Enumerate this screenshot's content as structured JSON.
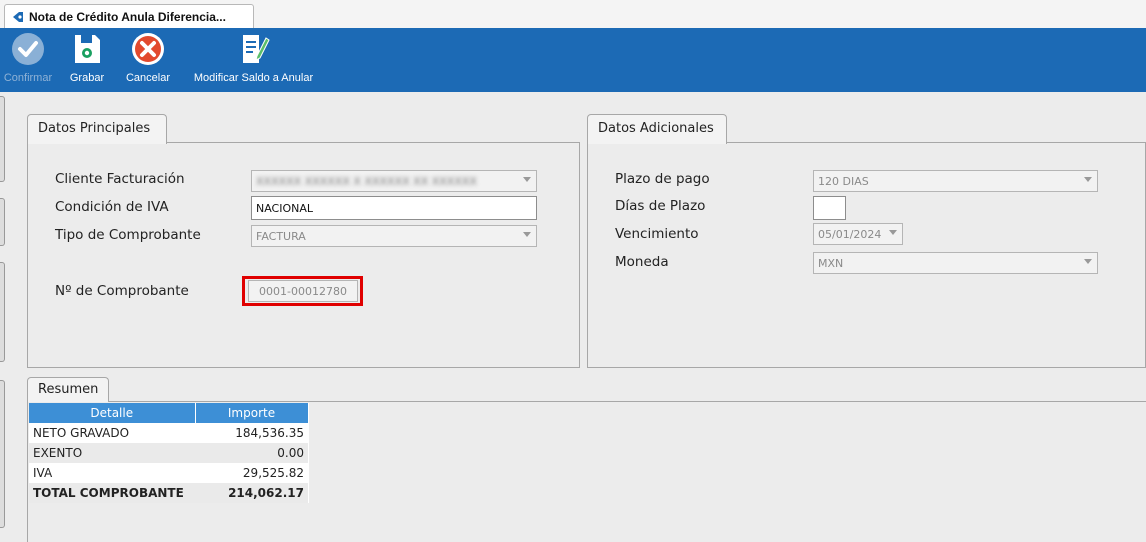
{
  "tab": {
    "title": "Nota de Crédito Anula Diferencia..."
  },
  "toolbar": {
    "confirmar": "Confirmar",
    "grabar": "Grabar",
    "cancelar": "Cancelar",
    "modificar": "Modificar Saldo a Anular"
  },
  "principales": {
    "tab_label": "Datos Principales",
    "cliente_label": "Cliente Facturación",
    "cliente_value": "XXXXXX XXXXXX X XXXXXX XX XXXXXX",
    "iva_label": "Condición de IVA",
    "iva_value": "NACIONAL",
    "tipo_label": "Tipo de Comprobante",
    "tipo_value": "FACTURA",
    "numero_label": "Nº de Comprobante",
    "numero_value": "0001-00012780"
  },
  "adicionales": {
    "tab_label": "Datos Adicionales",
    "plazo_label": "Plazo de pago",
    "plazo_value": "120 DIAS",
    "dias_label": "Días de Plazo",
    "dias_value": "",
    "venc_label": "Vencimiento",
    "venc_value": "05/01/2024",
    "moneda_label": "Moneda",
    "moneda_value": "MXN"
  },
  "resumen": {
    "tab_label": "Resumen",
    "headers": {
      "detalle": "Detalle",
      "importe": "Importe"
    },
    "rows": [
      {
        "detalle": "NETO GRAVADO",
        "importe": "184,536.35"
      },
      {
        "detalle": "EXENTO",
        "importe": "0.00"
      },
      {
        "detalle": "IVA",
        "importe": "29,525.82"
      },
      {
        "detalle": "TOTAL COMPROBANTE",
        "importe": "214,062.17"
      }
    ]
  },
  "colors": {
    "toolbar": "#1c6ab5",
    "table_header": "#3d8fd6",
    "highlight": "#e00000"
  }
}
